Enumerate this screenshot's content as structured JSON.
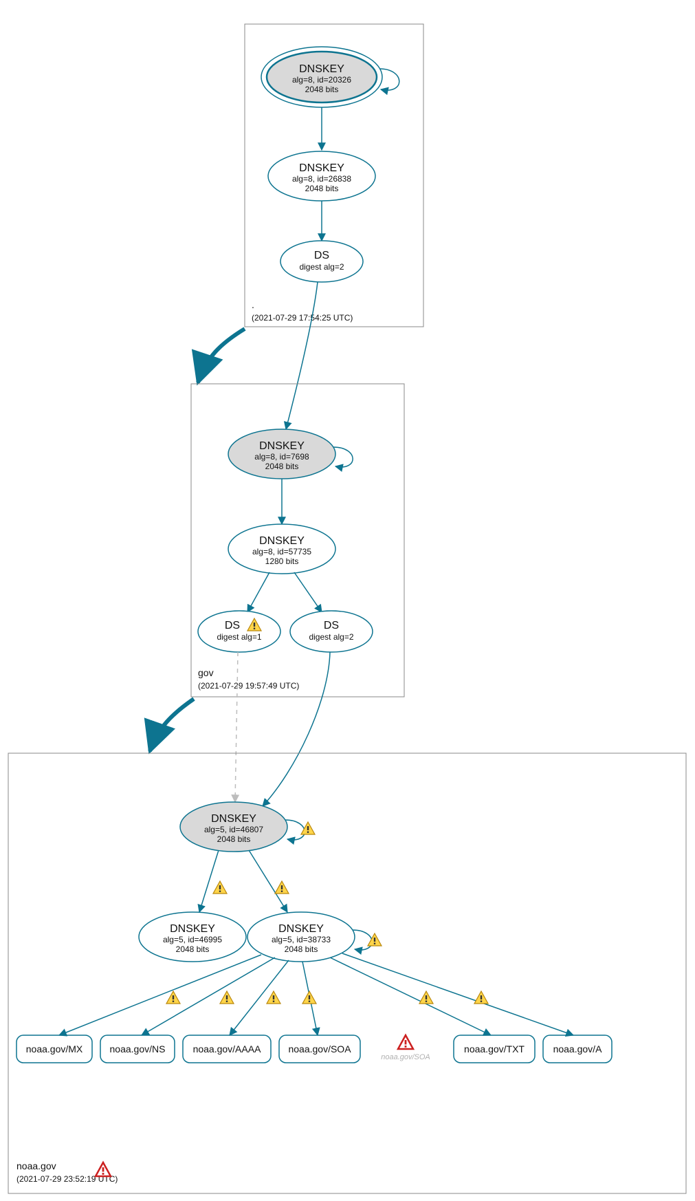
{
  "zones": {
    "root": {
      "label": ".",
      "timestamp": "(2021-07-29 17:54:25 UTC)"
    },
    "gov": {
      "label": "gov",
      "timestamp": "(2021-07-29 19:57:49 UTC)"
    },
    "noaa": {
      "label": "noaa.gov",
      "timestamp": "(2021-07-29 23:52:19 UTC)"
    }
  },
  "nodes": {
    "root_ksk": {
      "title": "DNSKEY",
      "line1": "alg=8, id=20326",
      "line2": "2048 bits"
    },
    "root_zsk": {
      "title": "DNSKEY",
      "line1": "alg=8, id=26838",
      "line2": "2048 bits"
    },
    "root_ds": {
      "title": "DS",
      "line1": "digest alg=2"
    },
    "gov_ksk": {
      "title": "DNSKEY",
      "line1": "alg=8, id=7698",
      "line2": "2048 bits"
    },
    "gov_zsk": {
      "title": "DNSKEY",
      "line1": "alg=8, id=57735",
      "line2": "1280 bits"
    },
    "gov_ds1": {
      "title": "DS",
      "line1": "digest alg=1"
    },
    "gov_ds2": {
      "title": "DS",
      "line1": "digest alg=2"
    },
    "noaa_ksk": {
      "title": "DNSKEY",
      "line1": "alg=5, id=46807",
      "line2": "2048 bits"
    },
    "noaa_zsk1": {
      "title": "DNSKEY",
      "line1": "alg=5, id=46995",
      "line2": "2048 bits"
    },
    "noaa_zsk2": {
      "title": "DNSKEY",
      "line1": "alg=5, id=38733",
      "line2": "2048 bits"
    },
    "rr_mx": {
      "label": "noaa.gov/MX"
    },
    "rr_ns": {
      "label": "noaa.gov/NS"
    },
    "rr_aaaa": {
      "label": "noaa.gov/AAAA"
    },
    "rr_soa": {
      "label": "noaa.gov/SOA"
    },
    "rr_soa_g": {
      "label": "noaa.gov/SOA"
    },
    "rr_txt": {
      "label": "noaa.gov/TXT"
    },
    "rr_a": {
      "label": "noaa.gov/A"
    }
  }
}
